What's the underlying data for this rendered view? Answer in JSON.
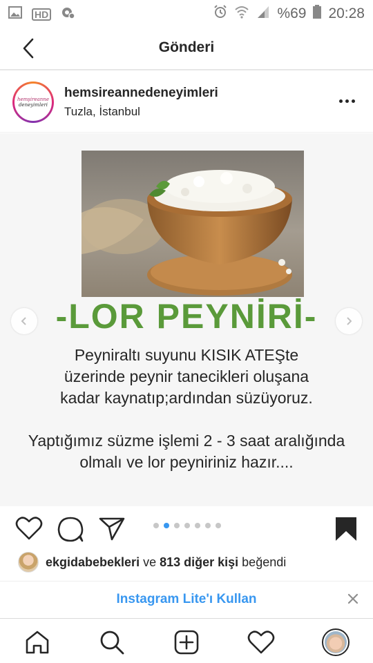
{
  "status_bar": {
    "battery_percent": "%69",
    "time": "20:28",
    "left_icons": [
      "image-icon",
      "hd-icon",
      "settings-notification-icon"
    ],
    "right_icons": [
      "alarm-icon",
      "wifi-icon",
      "signal-icon",
      "battery-icon"
    ],
    "hd_label": "HD"
  },
  "header": {
    "title": "Gönderi"
  },
  "post": {
    "username": "hemsireannedeneyimleri",
    "location": "Tuzla, İstanbul",
    "avatar_text_1": "hemşireanne",
    "avatar_text_2": "deneyimleri",
    "image_title": "-LOR PEYNİRİ-",
    "image_text_1": "Peyniraltı suyunu KISIK ATEŞte üzerinde peynir tanecikleri oluşana kadar kaynatıp;ardından  süzüyoruz.",
    "image_text_2": "Yaptığımız süzme işlemi 2 - 3 saat aralığında olmalı ve lor peyniriniz hazır....",
    "carousel": {
      "total": 7,
      "active": 2
    }
  },
  "likes": {
    "user": "ekgidabebekleri",
    "connector": " ve ",
    "count_text": "813 diğer kişi",
    "suffix": " beğendi"
  },
  "lite_banner": {
    "link_text": "Instagram Lite'ı Kullan"
  },
  "colors": {
    "accent_blue": "#3897f0",
    "title_green": "#5a9a3a",
    "text": "#262626"
  }
}
